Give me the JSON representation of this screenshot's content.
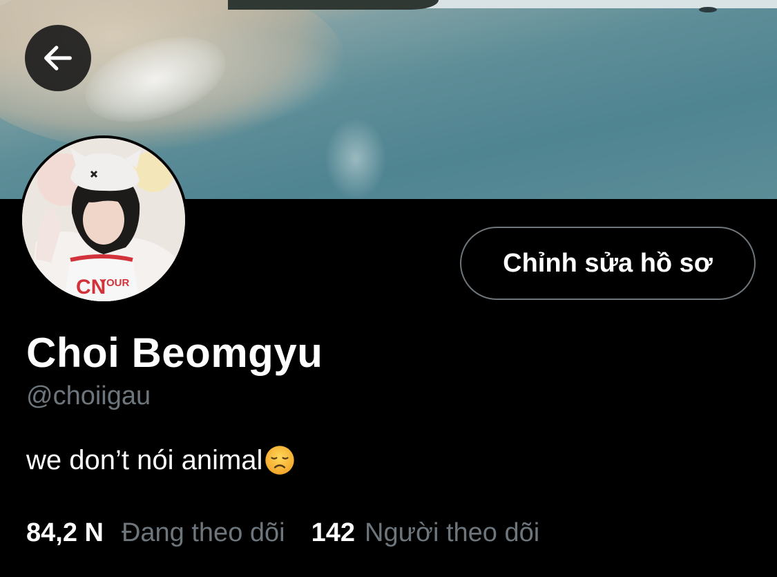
{
  "profile": {
    "display_name": "Choi Beomgyu",
    "handle": "@choiigau",
    "bio": "we don’t nói animal",
    "bio_emoji": "disappointed-face"
  },
  "actions": {
    "edit_profile_label": "Chỉnh sửa hồ sơ",
    "back_icon": "arrow-left-icon"
  },
  "stats": {
    "following_count": "84,2 N",
    "following_label": "Đang theo dõi",
    "followers_count": "142",
    "followers_label": "Người theo dõi"
  },
  "colors": {
    "background": "#000000",
    "text_primary": "#ffffff",
    "text_secondary": "#6e767d",
    "button_border": "#6f767b"
  }
}
